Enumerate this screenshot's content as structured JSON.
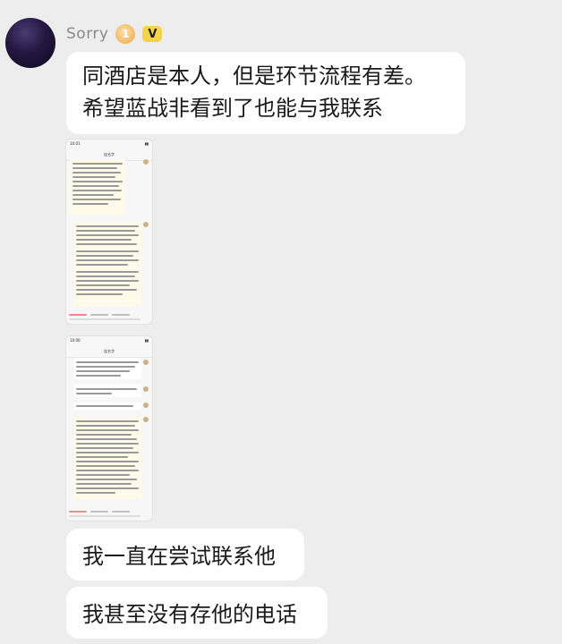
{
  "sender": {
    "name": "Sorry",
    "level": "1",
    "verified": "V"
  },
  "messages": [
    {
      "lines": [
        "同酒店是本人，但是环节流程有差。",
        "希望蓝战非看到了也能与我联系"
      ]
    },
    {
      "text": "我一直在尝试联系他"
    },
    {
      "text": "我甚至没有存他的电话"
    }
  ],
  "screenshots": [
    {
      "time": "10:01",
      "title": "连名字"
    },
    {
      "time": "10:00",
      "title": "连名字"
    }
  ],
  "colors": {
    "background": "#ededed",
    "bubble": "#ffffff",
    "level_badge": "#f1b866",
    "verified_badge": "#f4d44c"
  }
}
